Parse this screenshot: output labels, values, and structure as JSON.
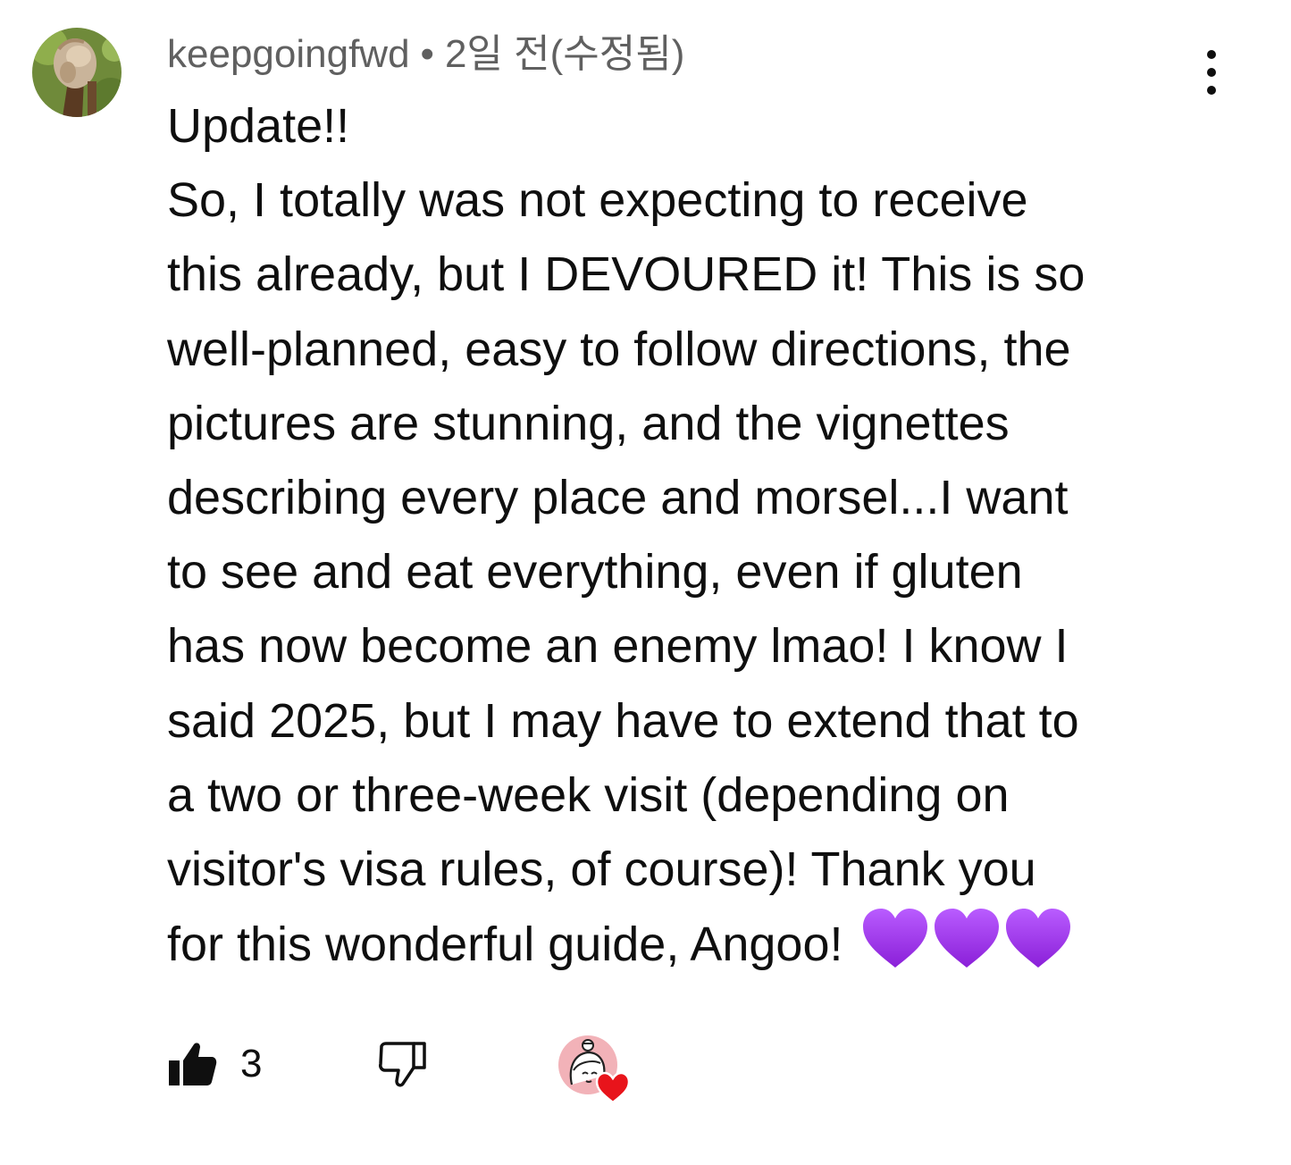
{
  "comment": {
    "author": "keepgoingfwd",
    "separator": "•",
    "timestamp": "2일 전(수정됨)",
    "lines": [
      "Update!!",
      "So, I totally was not expecting to receive",
      "this already, but I DEVOURED it! This is so",
      "well-planned, easy to follow directions, the",
      "pictures are stunning, and the vignettes",
      "describing every place and morsel...I want",
      "to see and eat everything, even if gluten",
      "has now become an enemy lmao! I know I",
      "said 2025, but I may have to extend that to",
      "a two or three-week visit (depending on",
      "visitor's visa rules, of course)! Thank you",
      "for this wonderful guide, Angoo!"
    ],
    "emoji": [
      "purple-heart",
      "purple-heart",
      "purple-heart"
    ],
    "like_count": "3"
  },
  "icons": {
    "menu": "more-vert-icon",
    "like": "thumbs-up-filled-icon",
    "dislike": "thumbs-down-outline-icon",
    "creator_heart": "creator-heart-icon"
  },
  "colors": {
    "text": "#0f0f0f",
    "meta": "#606060",
    "purple_heart": "#a33cf0",
    "red_heart": "#e8141b",
    "creator_avatar_bg": "#f2b2b8"
  }
}
